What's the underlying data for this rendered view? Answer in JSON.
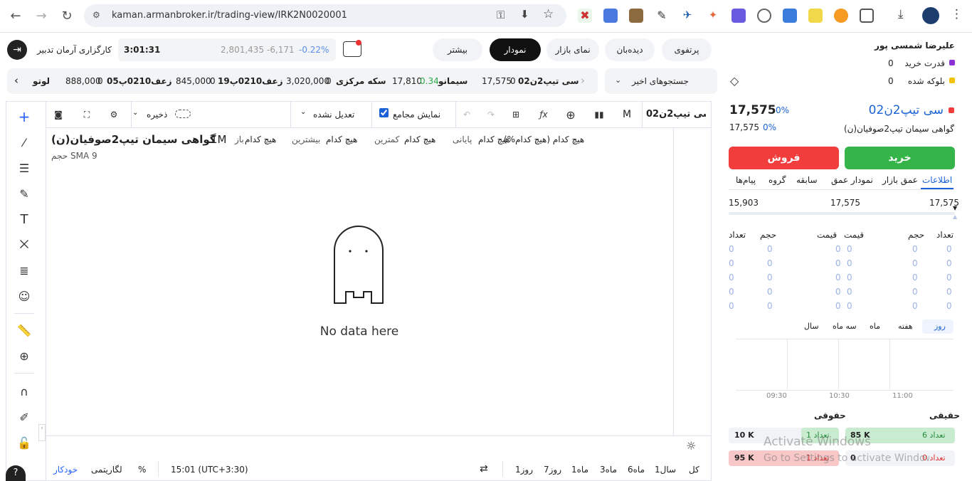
{
  "browser": {
    "url": "kaman.armanbroker.ir/trading-view/IRK2N0020001"
  },
  "header": {
    "broker_name": "کارگزاری آرمان تدبیر",
    "time": "3:01:31",
    "index_value": "2,801,435",
    "index_change": "-6,171",
    "index_percent": "-0.22%",
    "nav": [
      "بیشتر",
      "نمودار",
      "نمای بازار",
      "دیده‌بان",
      "پرتفوی"
    ],
    "active_nav": "نمودار"
  },
  "user": {
    "name": "علیرضا شمسی پور",
    "buying_power_label": "قدرت خرید",
    "buying_power": "0",
    "blocked_label": "بلوکه شده",
    "blocked": "0"
  },
  "ticker": {
    "recent_searches": "جستجوهای اخیر",
    "items": [
      {
        "name": "سی تیپ2ن02",
        "qty": "0",
        "price": "17,575",
        "change": ""
      },
      {
        "name": "سیمانو",
        "qty": "",
        "price": "17,810",
        "change": "0.34"
      },
      {
        "name": "سکه مرکزی",
        "qty": "0",
        "price": "3,020,000",
        "change": ""
      },
      {
        "name": "زعف0210پ19",
        "qty": "0",
        "price": "845,000",
        "change": ""
      },
      {
        "name": "زعف0210پ05",
        "qty": "0",
        "price": "888,000",
        "change": ""
      },
      {
        "name": "لوتو",
        "qty": "",
        "price": "",
        "change": ""
      }
    ]
  },
  "chart_toolbar": {
    "symbol": "سی تیپ2ن02",
    "interval": "M",
    "adjust": "تعدیل نشده",
    "show_aggregate": "نمایش مجامع",
    "save": "ذخیره"
  },
  "chart_legend": {
    "title": "گواهی سیمان تیپ2صوفیان(ن)",
    "interval": "1M",
    "open_label": "باز",
    "open": "هیچ کدام",
    "high_label": "بیشترین",
    "high": "هیچ کدام",
    "low_label": "کمترین",
    "low": "هیچ کدام",
    "close_label": "پایانی",
    "close": "هیچ کدام",
    "change": "هیچ کدام (هیچ کدام%)",
    "indicator": "حجم SMA 9",
    "empty_text": "No data here"
  },
  "chart_footer": {
    "ranges": [
      "کل",
      "1سال",
      "6ماه",
      "3ماه",
      "1ماه",
      "7روز",
      "1روز"
    ],
    "timezone": "15:01 (UTC+3:30)",
    "percent": "%",
    "log": "لگاریتمی",
    "auto": "خودکار"
  },
  "symbol_panel": {
    "symbol": "سی تیپ2ن02",
    "full_name": "گواهی سیمان تیپ2صوفیان(ن)",
    "last_price": "17,575",
    "last_percent": "0%",
    "close_price": "17,575",
    "close_percent": "0%",
    "buy": "خرید",
    "sell": "فروش",
    "tabs": [
      "اطلاعات",
      "عمق بازار",
      "نمودار عمق",
      "سابقه",
      "گروه",
      "پیام‌ها"
    ],
    "active_tab": "اطلاعات",
    "range_high": "17,575",
    "range_mid": "17,575",
    "range_low": "15,903",
    "book_headers": [
      "تعداد",
      "حجم",
      "قیمت",
      "قیمت",
      "حجم",
      "تعداد"
    ],
    "book_rows": [
      [
        "0",
        "0",
        "0",
        "0",
        "0",
        "0"
      ],
      [
        "0",
        "0",
        "0",
        "0",
        "0",
        "0"
      ],
      [
        "0",
        "0",
        "0",
        "0",
        "0",
        "0"
      ],
      [
        "0",
        "0",
        "0",
        "0",
        "0",
        "0"
      ],
      [
        "0",
        "0",
        "0",
        "0",
        "0",
        "0"
      ]
    ],
    "periods": [
      "روز",
      "هفته",
      "ماه",
      "سه ماه",
      "سال"
    ],
    "active_period": "روز",
    "time_ticks": [
      "11:00",
      "10:30",
      "09:30"
    ],
    "real_buy_label": "حقیقی",
    "real_sell_label": "حقوقی",
    "buy_count_label": "تعداد 6",
    "buy_volume": "85 K",
    "buy2_count_label": "تعداد 1",
    "buy2_volume": "10 K",
    "sell_count_label": "تعداد 0",
    "sell_volume": "0",
    "sell2_count_label": "تعداد 1",
    "sell2_volume": "95 K",
    "colors": {
      "buy": "#35b44a",
      "sell": "#f23d3d",
      "accent": "#1a62d6"
    }
  },
  "watermark": {
    "line1": "Activate Windows",
    "line2": "Go to Settings to activate Windows."
  }
}
